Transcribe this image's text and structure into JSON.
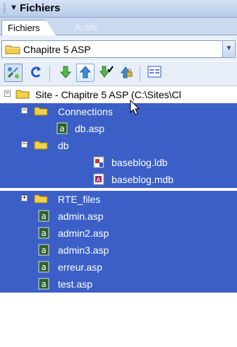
{
  "panel": {
    "title": "Fichiers"
  },
  "tabs": [
    {
      "label": "Fichiers",
      "active": true
    },
    {
      "label": "Actifs",
      "active": false
    }
  ],
  "site_select": {
    "value": "Chapitre 5 ASP",
    "icon": "folder-icon"
  },
  "toolbar": {
    "buttons": [
      {
        "name": "connect-button",
        "icon": "connect-icon"
      },
      {
        "name": "refresh-button",
        "icon": "refresh-icon"
      },
      {
        "name": "get-button",
        "icon": "download-arrow-icon"
      },
      {
        "name": "put-button",
        "icon": "upload-arrow-icon"
      },
      {
        "name": "check-out-button",
        "icon": "check-out-icon"
      },
      {
        "name": "check-in-button",
        "icon": "check-in-icon"
      },
      {
        "name": "expand-button",
        "icon": "expand-icon"
      }
    ]
  },
  "tree": {
    "items": [
      {
        "label": "Site - Chapitre 5 ASP (C:\\Sites\\Cl",
        "type": "site",
        "selected": false,
        "expander": "−"
      },
      {
        "label": "Connections",
        "type": "folder",
        "selected": true,
        "expander": "−"
      },
      {
        "label": "db.asp",
        "type": "asp",
        "selected": true
      },
      {
        "label": "db",
        "type": "folder",
        "selected": true,
        "expander": "−"
      },
      {
        "label": "baseblog.ldb",
        "type": "ldb",
        "selected": true
      },
      {
        "label": "baseblog.mdb",
        "type": "mdb",
        "selected": true
      },
      {
        "label": "RTE_files",
        "type": "folder",
        "selected": true,
        "expander": "+"
      },
      {
        "label": "admin.asp",
        "type": "asp",
        "selected": true
      },
      {
        "label": "admin2.asp",
        "type": "asp",
        "selected": true
      },
      {
        "label": "admin3.asp",
        "type": "asp",
        "selected": true
      },
      {
        "label": "erreur.asp",
        "type": "asp",
        "selected": true
      },
      {
        "label": "test.asp",
        "type": "asp",
        "selected": true
      }
    ]
  },
  "colors": {
    "selection": "#3b5fc7",
    "titlebar": "#c8d8ef",
    "folder": "#f3d04a"
  }
}
